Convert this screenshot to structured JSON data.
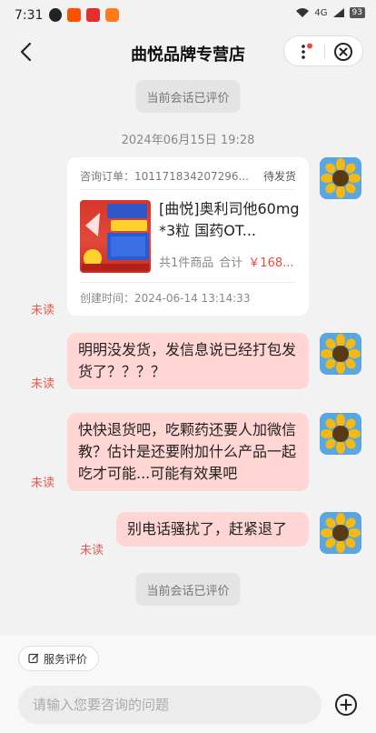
{
  "status_bar": {
    "time": "7:31",
    "network": "4G",
    "battery": "93"
  },
  "nav": {
    "title": "曲悦品牌专营店"
  },
  "chat": {
    "system_top": "当前会话已评价",
    "timestamp": "2024年06月15日 19:28",
    "system_bottom": "当前会话已评价",
    "order_card": {
      "order_no": "咨询订单：101171834207296...",
      "status": "待发货",
      "product_name": "[曲悦]奥利司他60mg*3粒 国药OT...",
      "count": "共1件商品",
      "total_label": "合计",
      "price": "￥168...",
      "created": "创建时间：2024-06-14 13:14:33"
    },
    "messages": [
      {
        "text": "明明没发货，发信息说已经打包发货了？？？？",
        "read_state": "未读"
      },
      {
        "text": "快快退货吧，吃颗药还要人加微信教？估计是还要附加什么产品一起吃才可能...可能有效果吧",
        "read_state": "未读"
      },
      {
        "text": "别电话骚扰了，赶紧退了",
        "read_state": "未读"
      }
    ]
  },
  "bottom": {
    "rate_button": "服务评价",
    "input_placeholder": "请输入您要咨询的问题"
  },
  "colors": {
    "accent": "#f0483e",
    "bubble": "#ffd6d4",
    "unread": "#e55a4b"
  }
}
